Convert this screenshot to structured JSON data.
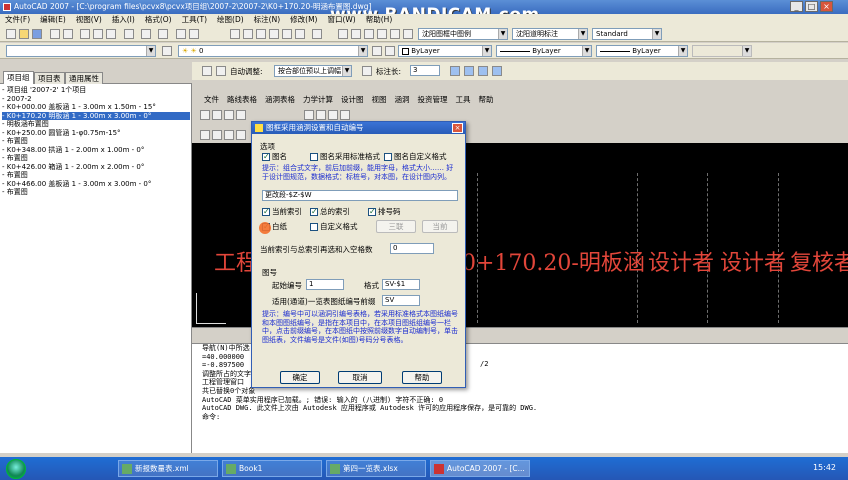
{
  "window": {
    "title": "AutoCAD 2007 - [C:\\program files\\pcvx8\\pcvx项目组\\2007-2\\2007-2\\K0+170.20-明涵布置图.dwg]",
    "watermark": "www.BANDICAM.com"
  },
  "menubar": [
    "文件(F)",
    "编辑(E)",
    "视图(V)",
    "插入(I)",
    "格式(O)",
    "工具(T)",
    "绘图(D)",
    "标注(N)",
    "修改(M)",
    "窗口(W)",
    "帮助(H)"
  ],
  "toolbar": {
    "layer_combo": "0",
    "style_combo": "沈阳图框中图例",
    "dimstyle_combo": "沈阳道明标注",
    "standard_combo": "Standard",
    "color_combo": "ByLayer",
    "linetype_combo": "ByLayer",
    "lineweight_combo": "ByLayer",
    "adjust_label": "自动调整:",
    "adjust_value": "按合部位预以上调幅",
    "scale_label": "标注长:",
    "scale_value": "3"
  },
  "left_panel": {
    "tabs": [
      "项目组",
      "项目表",
      "通用属性"
    ],
    "tree": [
      "- 项目组 '2007-2' 1个项目",
      "  - 2007-2",
      "    - K0+000.00 盖板涵 1 - 3.00m x 1.50m - 15°",
      "    - K0+170.20 明板涵 1 - 3.00m x 3.00m - 0°",
      "       - 明板涵布置图",
      "    - K0+250.00 圆管涵 1-φ0.75m-15°",
      "       - 布置图",
      "    - K0+348.00 拱涵 1 - 2.00m x 1.00m - 0°",
      "       - 布置图",
      "    - K0+426.00 箱涵 1 - 2.00m x 2.00m - 0°",
      "       - 布置图",
      "    - K0+466.00 盖板涵 1 - 3.00m x 3.00m - 0°",
      "       - 布置图"
    ],
    "selected_index": 3
  },
  "app_menubar": [
    "文件",
    "路线表格",
    "涵洞表格",
    "力学计算",
    "设计图",
    "视图",
    "涵洞",
    "投资管理",
    "工具",
    "帮助"
  ],
  "canvas": {
    "title_block": "工程",
    "title_block_2": "0+170.20-明板涵",
    "designer1": "设计者",
    "designer2": "设计者",
    "reviewer": "复核者"
  },
  "dialog": {
    "title": "图框采用涵洞设置和自动编号",
    "section_options": "选项",
    "opt_frame": "图名",
    "opt_frame_uses": "图名采用标准格式",
    "opt_custom": "图名自定义格式",
    "hint": "提示：组合式文字，前后加前缀，能用字母，格式大小……  好于设计图规范，数据格式：标桩号，对本图，在设计图内列。",
    "format_field": "更改段-$Z-$W",
    "chk_current_index": "当前索引",
    "chk_total_index": "总的索引",
    "chk_page_no": "排号码",
    "chk_blank": "白纸",
    "chk_custom_fmt": "自定义格式",
    "btn_delete": "三联",
    "btn_current": "当前",
    "index_label": "当前索引与总索引再选和入空格数",
    "index_value": "0",
    "section_figure": "图号",
    "start_label": "起始编号",
    "start_value": "1",
    "fmt_label": "格式",
    "fmt_value": "SV-$1",
    "prefix_label": "适用(通道)一览表图纸编号前缀",
    "prefix_value": "SV",
    "note": "提示：编号中可以涵洞引编号表格，若采用标准格式本图纸编号和本图图纸编号，是指在本项目中，在本项目图纸组编号一栏中，点击前缀编号，在本图纸中按照前缀数字自动编制号，单击图纸表，文件编号是文件(如图)号码分号表格。",
    "btn_ok": "确定",
    "btn_cancel": "取消",
    "btn_help": "帮助"
  },
  "command_window": [
    "导航(N)中所选 (宽) :",
    "=40.000000",
    "=-0.897500",
    "调整所占的文字:",
    "工程管理窗口",
    "共已替换0个对象",
    "AutoCAD 菜单实用程序已加载。; 错误: 输入的 (八进制) 字符不正确: 0",
    "AutoCAD DWG.   此文件上次由 Autodesk 应用程序或 Autodesk 许可的应用程序保存，是可靠的 DWG.",
    "",
    "命令:"
  ],
  "command_extra": "/2",
  "taskbar": {
    "tasks": [
      "新报数量表.xml",
      "Book1",
      "第四一览表.xlsx",
      "AutoCAD 2007 - [C..."
    ],
    "clock": "15:42"
  }
}
